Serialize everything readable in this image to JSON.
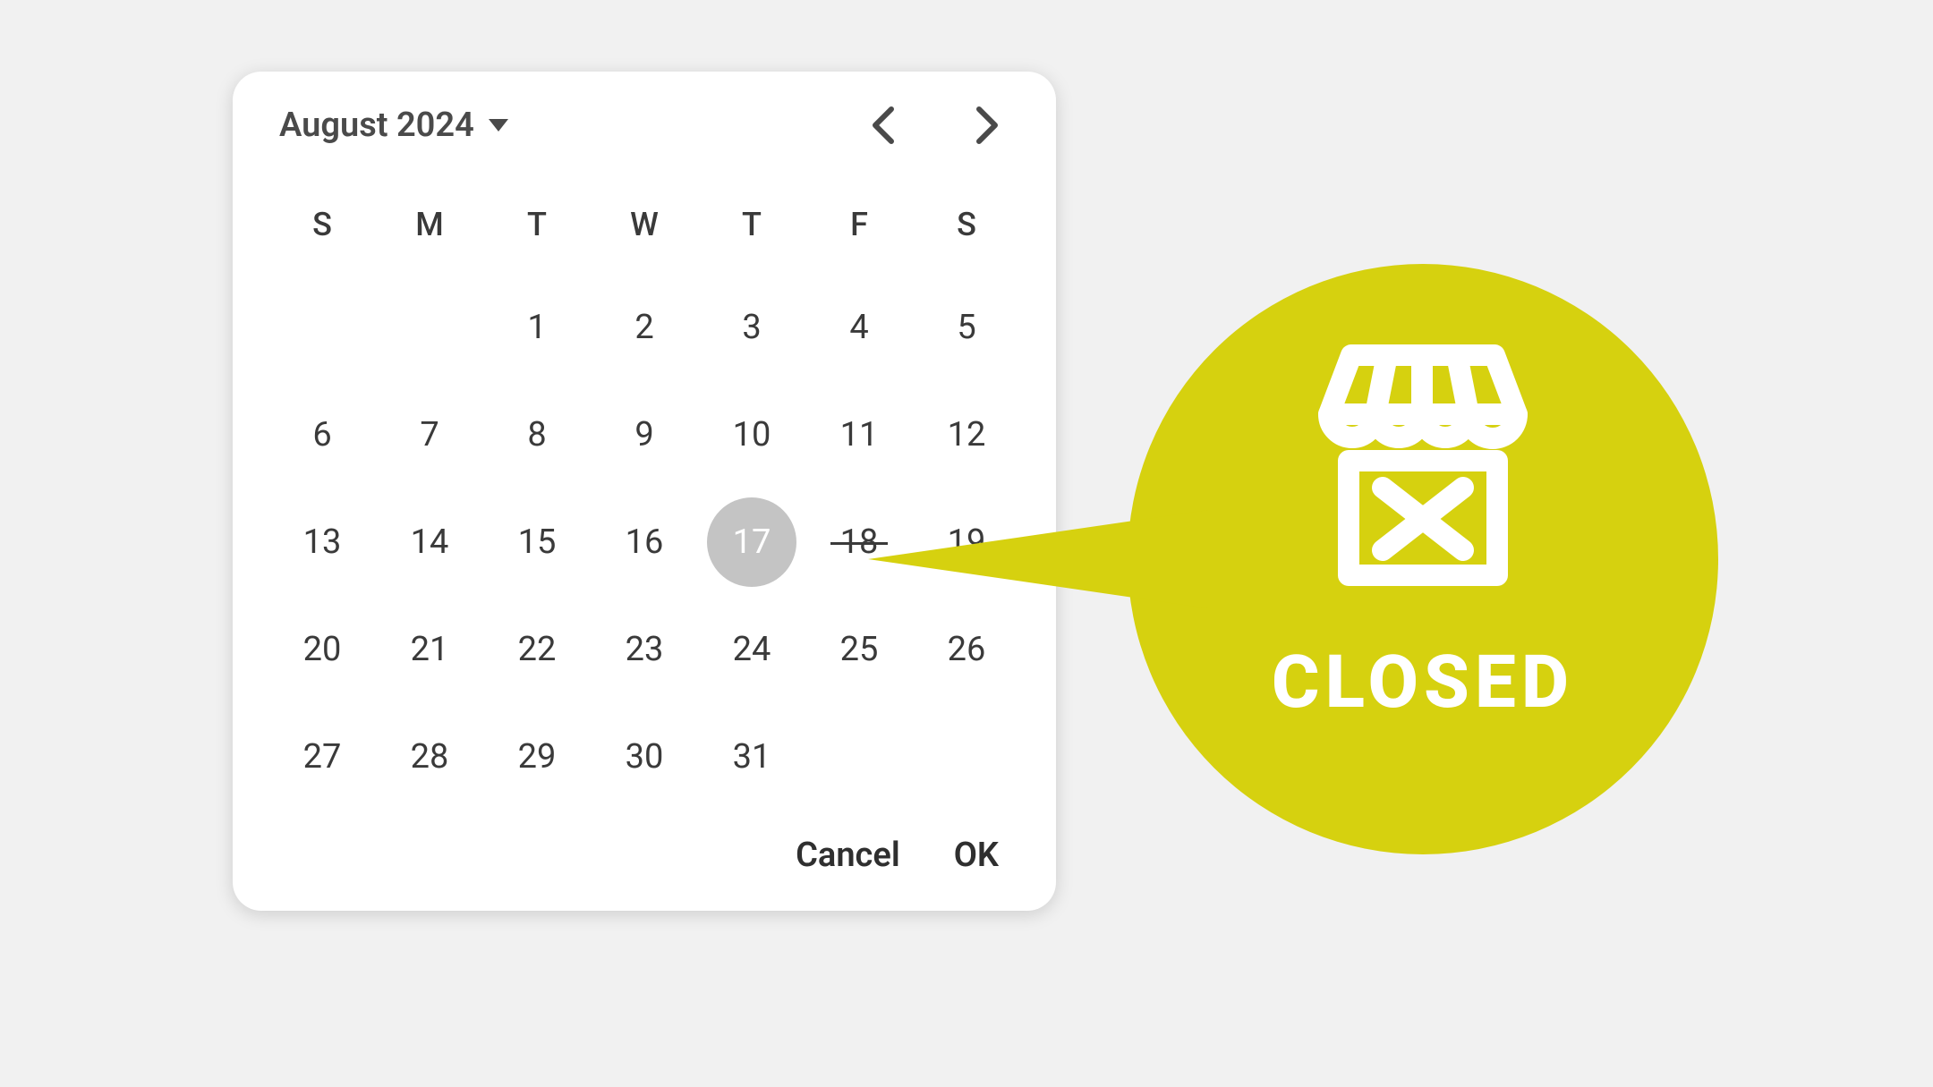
{
  "datepicker": {
    "month_label": "August 2024",
    "dow": [
      "S",
      "M",
      "T",
      "W",
      "T",
      "F",
      "S"
    ],
    "weeks": [
      [
        null,
        null,
        null,
        1,
        2,
        3,
        4,
        5
      ],
      [
        6,
        7,
        8,
        9,
        10,
        11,
        12
      ],
      [
        13,
        14,
        15,
        16,
        17,
        18,
        19
      ],
      [
        20,
        21,
        22,
        23,
        24,
        25,
        26
      ],
      [
        27,
        28,
        29,
        30,
        31,
        null,
        null
      ]
    ],
    "selected_day": 17,
    "unavailable_day": 18,
    "actions": {
      "cancel": "Cancel",
      "ok": "OK"
    }
  },
  "callout": {
    "label": "CLOSED",
    "color": "#d6d10f"
  }
}
